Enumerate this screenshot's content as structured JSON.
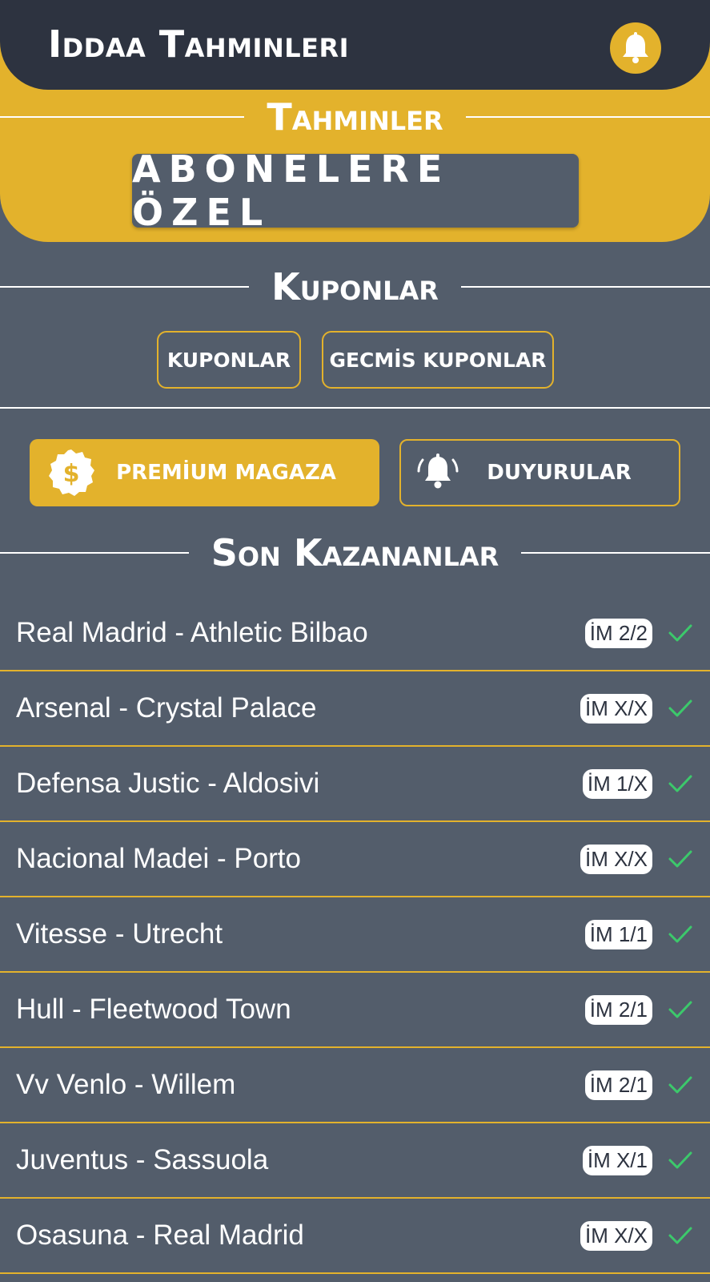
{
  "app": {
    "title": "Iddaa Tahminleri",
    "accent_color": "#e3b22c",
    "header_color": "#2d3340",
    "background_color": "#535d6b",
    "success_color": "#3cc96b"
  },
  "header": {
    "notification_icon": "bell-icon"
  },
  "predictions": {
    "heading": "Tahminler",
    "exclusive_label": "ABONELERE ÖZEL"
  },
  "coupons": {
    "heading": "Kuponlar",
    "buttons": [
      {
        "label": "KUPONLAR"
      },
      {
        "label": "GECMİS KUPONLAR"
      }
    ]
  },
  "actions": {
    "premium_label": "PREMİUM MAGAZA",
    "premium_icon": "dollar-badge-icon",
    "announcements_label": "DUYURULAR",
    "announcements_icon": "bell-icon"
  },
  "recent_winners": {
    "heading": "Son Kazananlar",
    "items": [
      {
        "match": "Real Madrid - Athletic Bilbao",
        "pick": "İM 2/2"
      },
      {
        "match": "Arsenal - Crystal Palace",
        "pick": "İM X/X"
      },
      {
        "match": "Defensa Justic - Aldosivi",
        "pick": "İM 1/X"
      },
      {
        "match": "Nacional Madei - Porto",
        "pick": "İM X/X"
      },
      {
        "match": "Vitesse - Utrecht",
        "pick": "İM 1/1"
      },
      {
        "match": "Hull - Fleetwood Town",
        "pick": "İM 2/1"
      },
      {
        "match": "Vv Venlo - Willem",
        "pick": "İM 2/1"
      },
      {
        "match": "Juventus - Sassuola",
        "pick": "İM X/1"
      },
      {
        "match": "Osasuna - Real Madrid",
        "pick": "İM X/X"
      }
    ]
  }
}
